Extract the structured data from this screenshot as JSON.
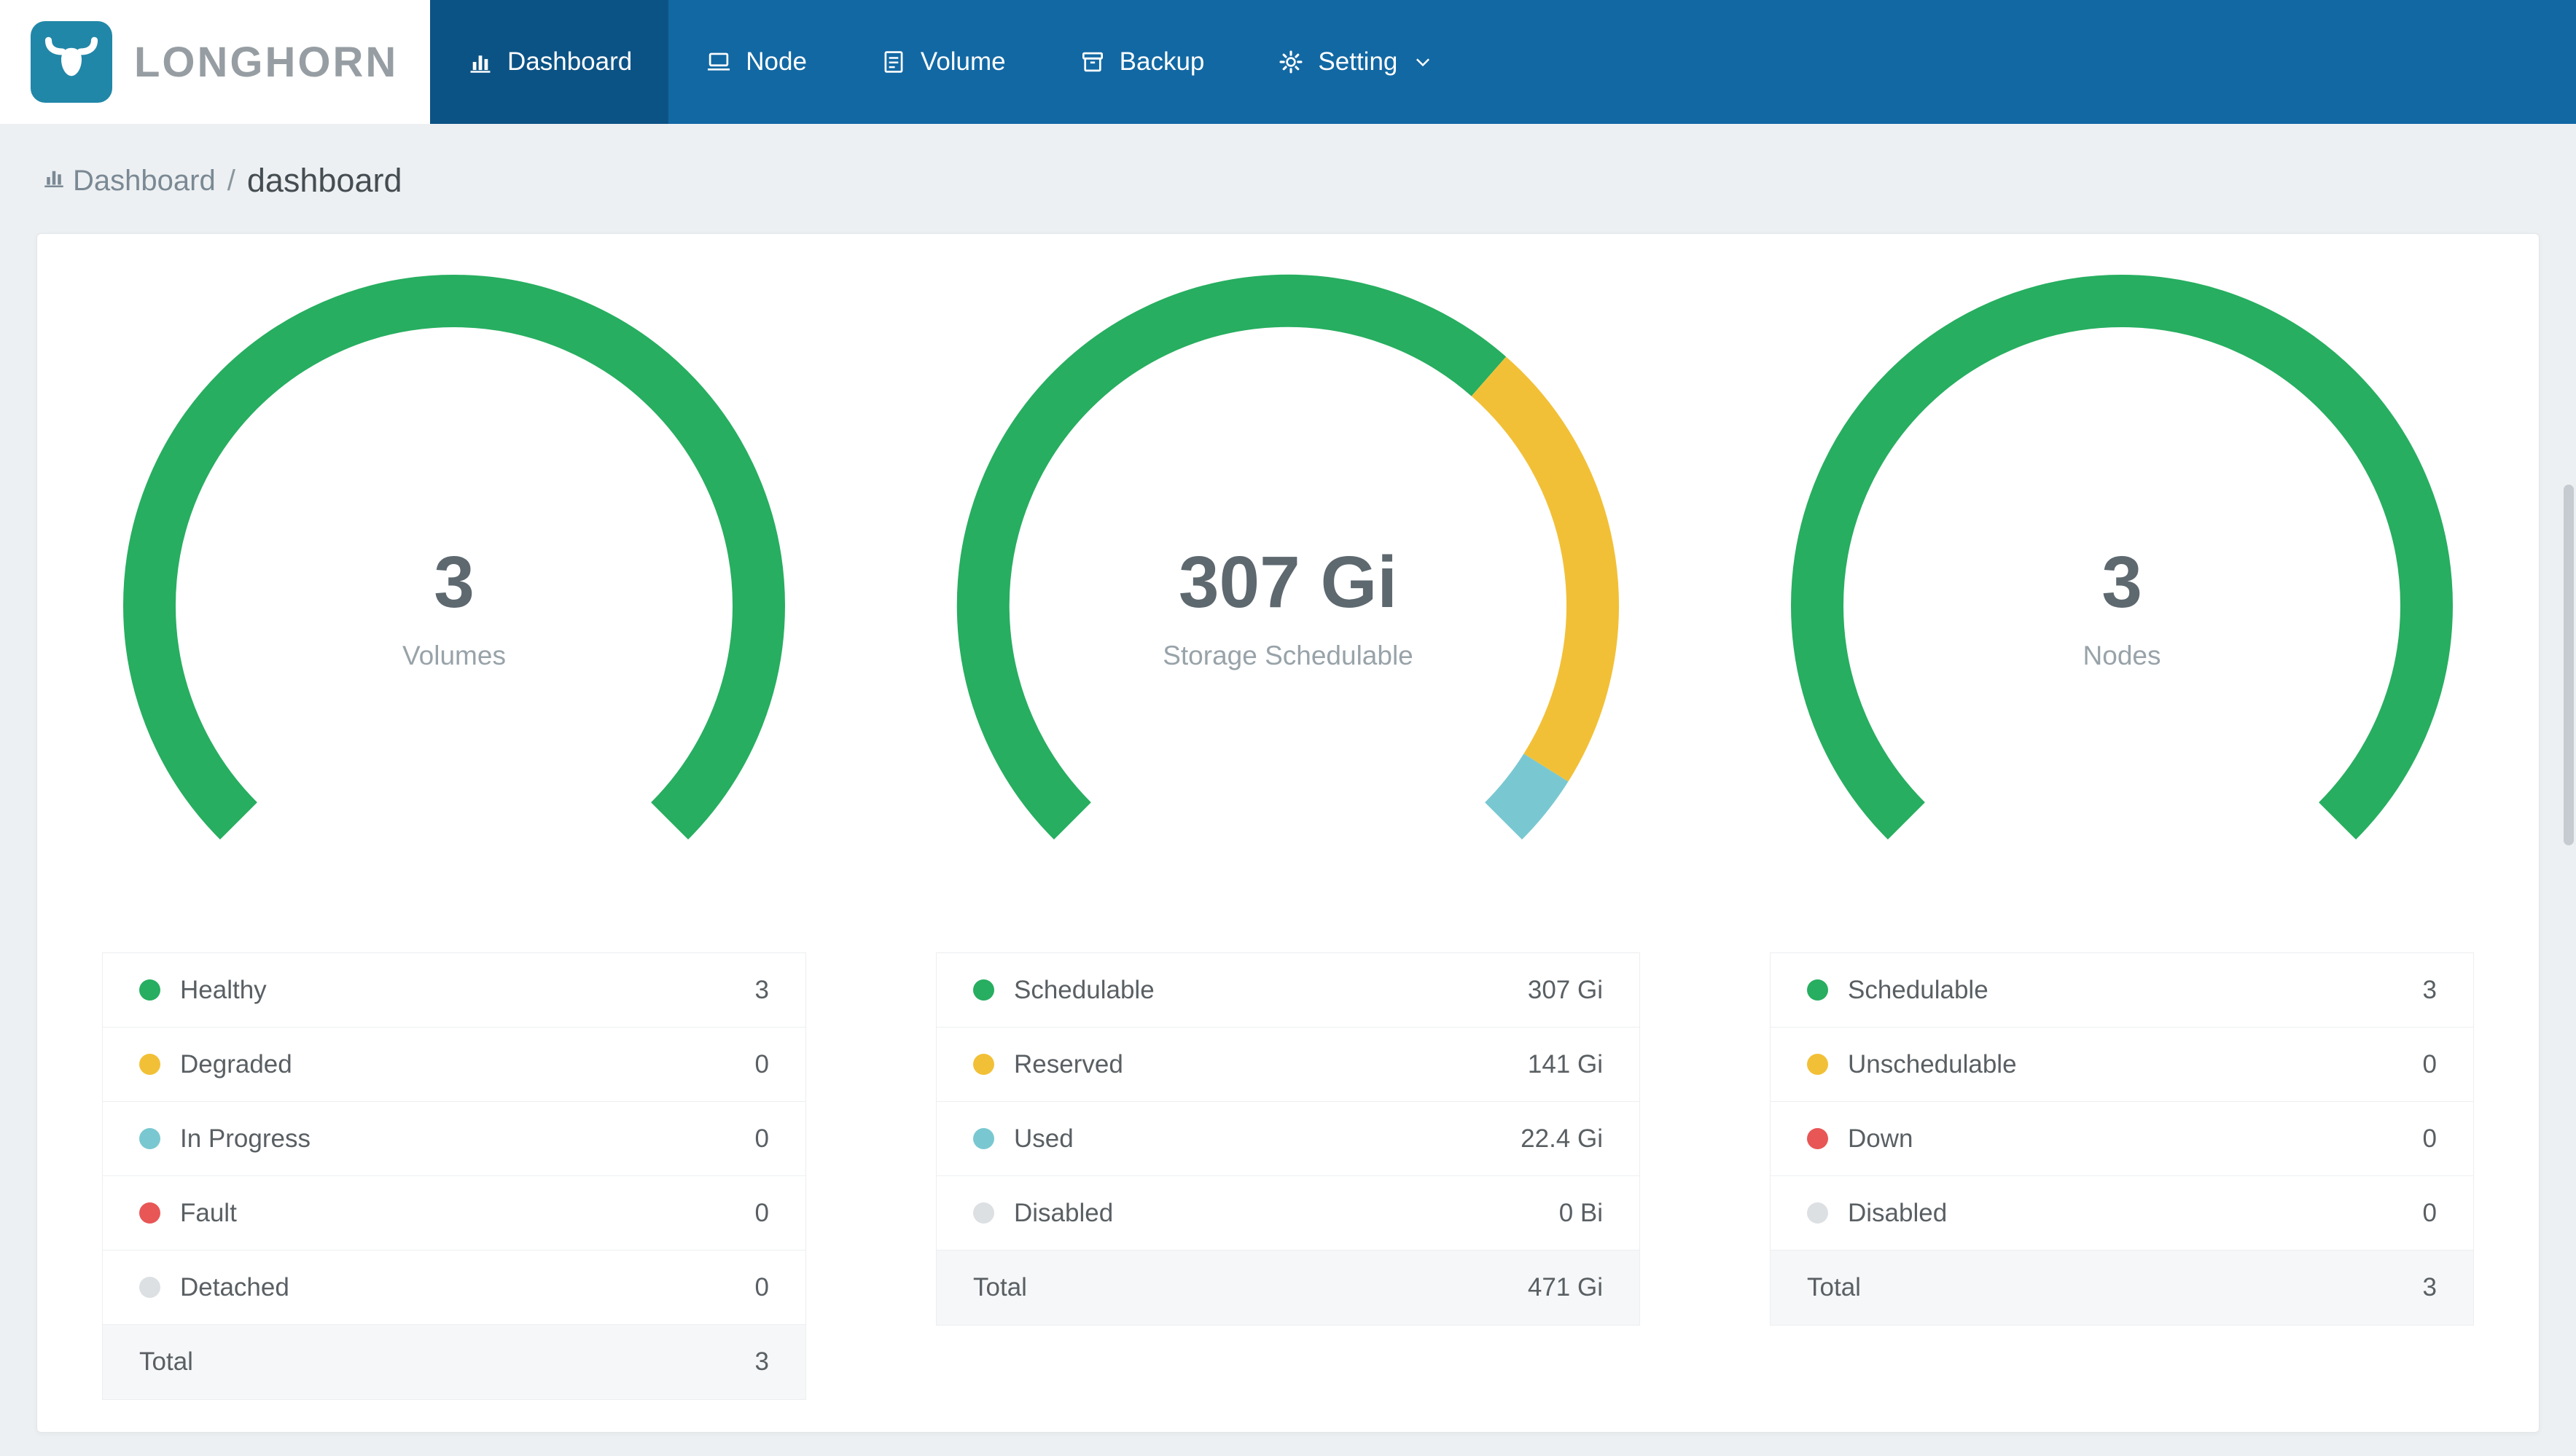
{
  "header": {
    "logo_text": "LONGHORN",
    "nav_items": [
      {
        "label": "Dashboard",
        "active": true
      },
      {
        "label": "Node",
        "active": false
      },
      {
        "label": "Volume",
        "active": false
      },
      {
        "label": "Backup",
        "active": false
      },
      {
        "label": "Setting",
        "active": false,
        "dropdown": true
      }
    ]
  },
  "breadcrumb": {
    "root": "Dashboard",
    "separator": "/",
    "current": "dashboard"
  },
  "colors": {
    "green": "#27ae60",
    "yellow": "#f2c037",
    "teal": "#79c8d1",
    "red": "#e85656",
    "gray": "#dce0e3",
    "nav_bg": "#1268a3",
    "nav_active": "#0c5385",
    "logo_teal": "#2187a8"
  },
  "chart_data": [
    {
      "type": "gauge",
      "center_value": "3",
      "center_label": "Volumes",
      "start_angle": 225,
      "sweep": 270,
      "segments": [
        {
          "label": "Healthy",
          "value": 3,
          "display": "3",
          "color": "green"
        },
        {
          "label": "Degraded",
          "value": 0,
          "display": "0",
          "color": "yellow"
        },
        {
          "label": "In Progress",
          "value": 0,
          "display": "0",
          "color": "teal"
        },
        {
          "label": "Fault",
          "value": 0,
          "display": "0",
          "color": "red"
        },
        {
          "label": "Detached",
          "value": 0,
          "display": "0",
          "color": "gray"
        }
      ],
      "total_label": "Total",
      "total_display": "3"
    },
    {
      "type": "gauge",
      "center_value": "307 Gi",
      "center_label": "Storage Schedulable",
      "start_angle": 225,
      "sweep": 270,
      "segments": [
        {
          "label": "Schedulable",
          "value": 307,
          "display": "307 Gi",
          "color": "green"
        },
        {
          "label": "Reserved",
          "value": 141,
          "display": "141 Gi",
          "color": "yellow"
        },
        {
          "label": "Used",
          "value": 22.4,
          "display": "22.4 Gi",
          "color": "teal"
        },
        {
          "label": "Disabled",
          "value": 0,
          "display": "0 Bi",
          "color": "gray"
        }
      ],
      "total_label": "Total",
      "total_display": "471 Gi"
    },
    {
      "type": "gauge",
      "center_value": "3",
      "center_label": "Nodes",
      "start_angle": 225,
      "sweep": 270,
      "segments": [
        {
          "label": "Schedulable",
          "value": 3,
          "display": "3",
          "color": "green"
        },
        {
          "label": "Unschedulable",
          "value": 0,
          "display": "0",
          "color": "yellow"
        },
        {
          "label": "Down",
          "value": 0,
          "display": "0",
          "color": "red"
        },
        {
          "label": "Disabled",
          "value": 0,
          "display": "0",
          "color": "gray"
        }
      ],
      "total_label": "Total",
      "total_display": "3"
    }
  ]
}
